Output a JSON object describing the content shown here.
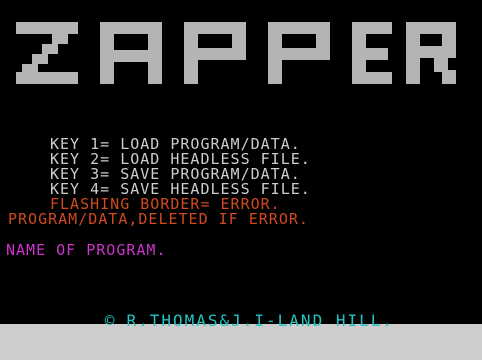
{
  "screen": {
    "title": "ZAPPER",
    "colors": {
      "paper": "#000000",
      "border": "#cdcdcd",
      "white": "#cdcdcd",
      "red": "#d04a1e",
      "magenta": "#cd32cd",
      "cyan": "#22c4c4"
    },
    "menu": [
      "KEY 1= LOAD PROGRAM/DATA.",
      "KEY 2= LOAD HEADLESS FILE.",
      "KEY 3= SAVE PROGRAM/DATA.",
      "KEY 4= SAVE HEADLESS FILE."
    ],
    "warning_1": "FLASHING BORDER= ERROR.",
    "warning_2": "PROGRAM/DATA,DELETED IF ERROR.",
    "prompt": "NAME OF PROGRAM.",
    "credits": "R.THOMAS&J.I-LAND HILL.",
    "credits_icon": "copyright-icon"
  }
}
